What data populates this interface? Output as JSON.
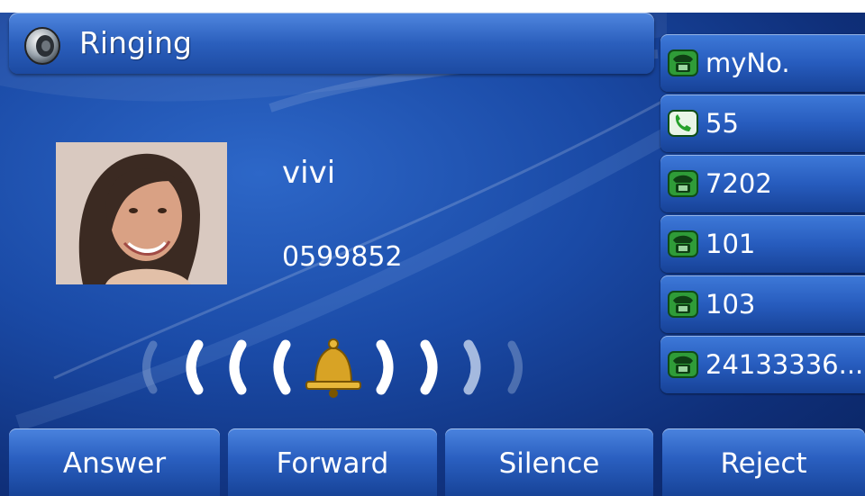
{
  "status": {
    "label": "Ringing",
    "icon": "speaker-icon"
  },
  "caller": {
    "name": "vivi",
    "number": "0599852",
    "avatar": "caller-photo"
  },
  "ring_indicator": {
    "icon": "bell-icon"
  },
  "lines": [
    {
      "label": "myNo.",
      "icon": "desk-phone-icon"
    },
    {
      "label": "55",
      "icon": "handset-icon"
    },
    {
      "label": "7202",
      "icon": "desk-phone-icon"
    },
    {
      "label": "101",
      "icon": "desk-phone-icon"
    },
    {
      "label": "103",
      "icon": "desk-phone-icon"
    },
    {
      "label": "24133336...",
      "icon": "desk-phone-icon"
    }
  ],
  "softkeys": [
    {
      "label": "Answer"
    },
    {
      "label": "Forward"
    },
    {
      "label": "Silence"
    },
    {
      "label": "Reject"
    }
  ],
  "colors": {
    "accent": "#2b5fbd",
    "background": "#1a4aa6",
    "line_icon_green": "#27a02b"
  }
}
